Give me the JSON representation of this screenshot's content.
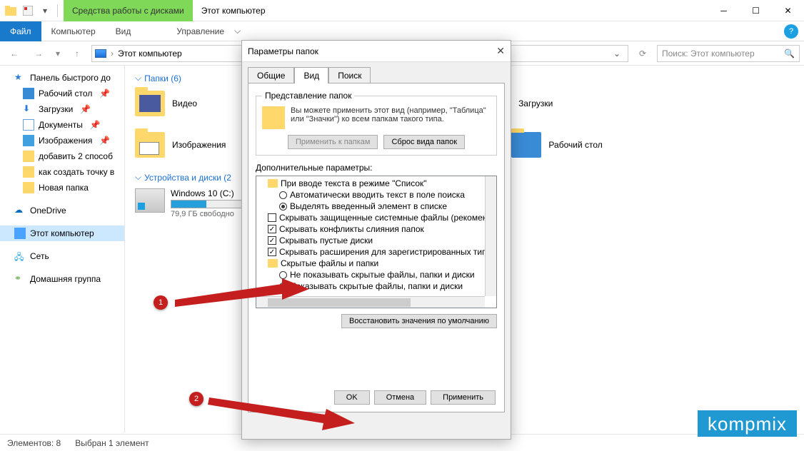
{
  "window": {
    "disk_tools": "Средства работы с дисками",
    "title": "Этот компьютер"
  },
  "ribbon": {
    "file": "Файл",
    "computer": "Компьютер",
    "view": "Вид",
    "manage": "Управление"
  },
  "address": {
    "path": "Этот компьютер",
    "search_placeholder": "Поиск: Этот компьютер"
  },
  "sidebar": {
    "quick": "Панель быстрого до",
    "desktop": "Рабочий стол",
    "downloads": "Загрузки",
    "documents": "Документы",
    "pictures": "Изображения",
    "add2ways": "добавить 2 способ",
    "howto": "как создать точку в",
    "newfolder": "Новая папка",
    "onedrive": "OneDrive",
    "thispc": "Этот компьютер",
    "network": "Сеть",
    "homegroup": "Домашняя группа"
  },
  "main": {
    "folders_hdr": "Папки (6)",
    "video": "Видео",
    "downloads": "Загрузки",
    "pictures": "Изображения",
    "desktop": "Рабочий стол",
    "drives_hdr": "Устройства и диски (2",
    "drive_name": "Windows 10 (C:)",
    "drive_free": "79,9 ГБ свободно"
  },
  "status": {
    "elements": "Элементов: 8",
    "selected": "Выбран 1 элемент"
  },
  "dialog": {
    "title": "Параметры папок",
    "tab_general": "Общие",
    "tab_view": "Вид",
    "tab_search": "Поиск",
    "fs_legend": "Представление папок",
    "fs_text": "Вы можете применить этот вид (например, \"Таблица\" или \"Значки\") ко всем папкам такого типа.",
    "apply_folders": "Применить к папкам",
    "reset_folders": "Сброс вида папок",
    "adv_label": "Дополнительные параметры:",
    "tree": {
      "r0": "При вводе текста в режиме \"Список\"",
      "r1": "Автоматически вводить текст в поле поиска",
      "r2": "Выделять введенный элемент в списке",
      "r3": "Скрывать защищенные системные файлы (рекомен.",
      "r4": "Скрывать конфликты слияния папок",
      "r5": "Скрывать пустые диски",
      "r6": "Скрывать расширения для зарегистрированных типо",
      "r7": "Скрытые файлы и папки",
      "r8": "Не показывать скрытые файлы, папки и диски",
      "r9": "Показывать скрытые файлы, папки и диски"
    },
    "restore": "Восстановить значения по умолчанию",
    "ok": "OK",
    "cancel": "Отмена",
    "apply": "Применить"
  },
  "annot": {
    "b1": "1",
    "b2": "2"
  },
  "watermark": "kompmix"
}
